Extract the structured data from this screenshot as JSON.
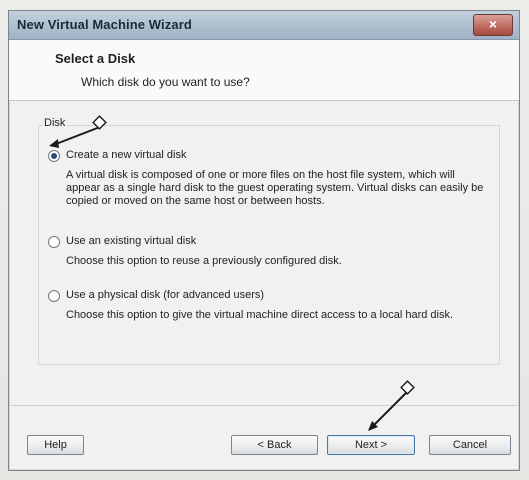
{
  "window": {
    "title": "New Virtual Machine Wizard",
    "close_label": "×"
  },
  "header": {
    "title": "Select a Disk",
    "subtitle": "Which disk do you want to use?"
  },
  "disk_group": {
    "label": "Disk",
    "options": [
      {
        "label": "Create a new virtual disk",
        "description": "A virtual disk is composed of one or more files on the host file system, which will appear as a single hard disk to the guest operating system. Virtual disks can easily be copied or moved on the same host or between hosts.",
        "selected": true
      },
      {
        "label": "Use an existing virtual disk",
        "description": "Choose this option to reuse a previously configured disk.",
        "selected": false
      },
      {
        "label": "Use a physical disk (for advanced users)",
        "description": "Choose this option to give the virtual machine direct access to a local hard disk.",
        "selected": false
      }
    ]
  },
  "footer": {
    "help_label": "Help",
    "back_label": "< Back",
    "next_label": "Next >",
    "cancel_label": "Cancel"
  }
}
